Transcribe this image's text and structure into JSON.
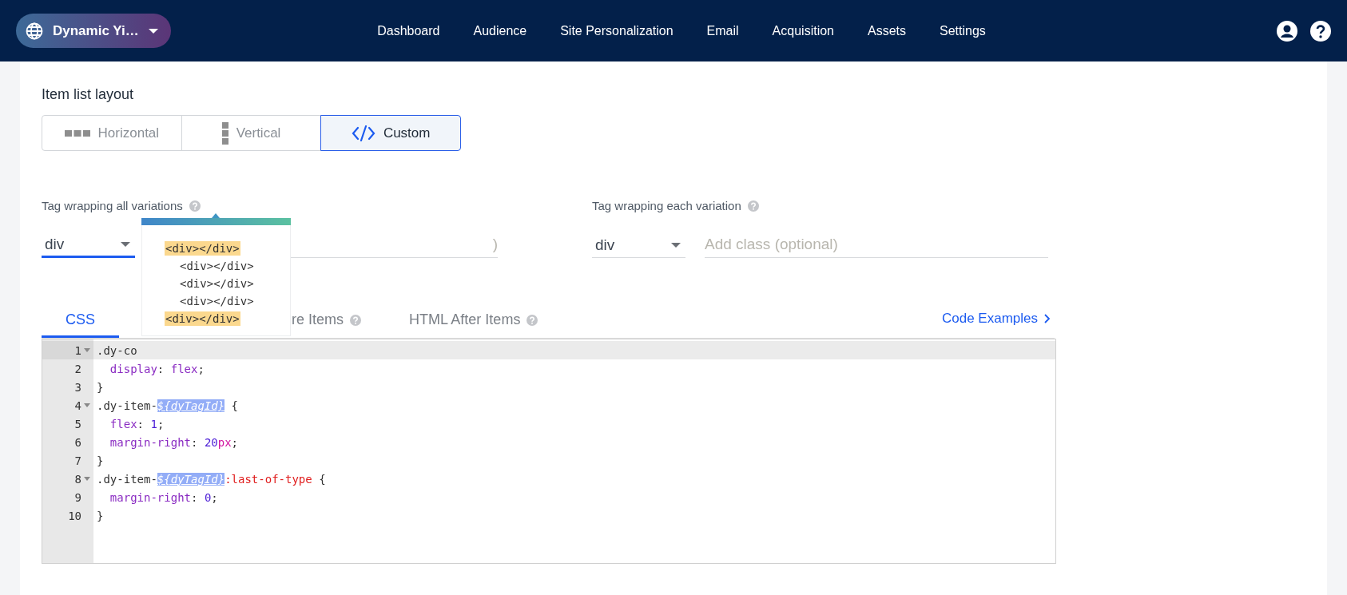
{
  "navbar": {
    "brand": "Dynamic Yi…",
    "links": [
      "Dashboard",
      "Audience",
      "Site Personalization",
      "Email",
      "Acquisition",
      "Assets",
      "Settings"
    ]
  },
  "layout": {
    "title": "Item list layout",
    "options": [
      {
        "label": "Horizontal",
        "kind": "horizontal",
        "selected": false
      },
      {
        "label": "Vertical",
        "kind": "vertical",
        "selected": false
      },
      {
        "label": "Custom",
        "kind": "code",
        "selected": true
      }
    ]
  },
  "wrap_all": {
    "label": "Tag wrapping all variations",
    "tag": "div",
    "focused": true,
    "class_placeholder": ")"
  },
  "wrap_each": {
    "label": "Tag wrapping each variation",
    "tag": "div",
    "focused": false,
    "class_placeholder": "Add class (optional)"
  },
  "tooltip": {
    "lines": [
      {
        "text": "<div></div>",
        "highlighted": true,
        "children": [
          {
            "text": "<div></div>",
            "highlighted": false
          },
          {
            "text": "<div></div>",
            "highlighted": false
          },
          {
            "text": "<div></div>",
            "highlighted": false
          }
        ]
      },
      {
        "text": "<div></div>",
        "highlighted": true
      }
    ]
  },
  "code_tabs": [
    {
      "label": "CSS",
      "selected": true,
      "help": false
    },
    {
      "label": "re Items",
      "selected": false,
      "help": true
    },
    {
      "label": "HTML After Items",
      "selected": false,
      "help": true
    }
  ],
  "code_examples": "Code Examples",
  "editor": {
    "lines": [
      {
        "number": "1",
        "folds": true,
        "active": true,
        "tokens": [
          {
            "text": ".dy-co",
            "kind": "plain"
          }
        ]
      },
      {
        "number": "2",
        "folds": false,
        "active": false,
        "tokens": [
          {
            "text": "  display",
            "kind": "property"
          },
          {
            "text": ": ",
            "kind": "plain"
          },
          {
            "text": "flex",
            "kind": "property"
          },
          {
            "text": ";",
            "kind": "plain"
          }
        ]
      },
      {
        "number": "3",
        "folds": false,
        "active": false,
        "tokens": [
          {
            "text": "}",
            "kind": "plain"
          }
        ]
      },
      {
        "number": "4",
        "folds": true,
        "active": false,
        "tokens": [
          {
            "text": ".dy-item-",
            "kind": "plain"
          },
          {
            "text": "${dyTagId}",
            "kind": "variable"
          },
          {
            "text": " {",
            "kind": "plain"
          }
        ]
      },
      {
        "number": "5",
        "folds": false,
        "active": false,
        "tokens": [
          {
            "text": "  flex",
            "kind": "property"
          },
          {
            "text": ": ",
            "kind": "plain"
          },
          {
            "text": "1",
            "kind": "number"
          },
          {
            "text": ";",
            "kind": "plain"
          }
        ]
      },
      {
        "number": "6",
        "folds": false,
        "active": false,
        "tokens": [
          {
            "text": "  margin-right",
            "kind": "property"
          },
          {
            "text": ": ",
            "kind": "plain"
          },
          {
            "text": "20",
            "kind": "number"
          },
          {
            "text": "px",
            "kind": "unit"
          },
          {
            "text": ";",
            "kind": "plain"
          }
        ]
      },
      {
        "number": "7",
        "folds": false,
        "active": false,
        "tokens": [
          {
            "text": "}",
            "kind": "plain"
          }
        ]
      },
      {
        "number": "8",
        "folds": true,
        "active": false,
        "tokens": [
          {
            "text": ".dy-item-",
            "kind": "plain"
          },
          {
            "text": "${dyTagId}",
            "kind": "variable"
          },
          {
            "text": ":last-of-type",
            "kind": "pseudo"
          },
          {
            "text": " {",
            "kind": "plain"
          }
        ]
      },
      {
        "number": "9",
        "folds": false,
        "active": false,
        "tokens": [
          {
            "text": "  margin-right",
            "kind": "property"
          },
          {
            "text": ": ",
            "kind": "plain"
          },
          {
            "text": "0",
            "kind": "number"
          },
          {
            "text": ";",
            "kind": "plain"
          }
        ]
      },
      {
        "number": "10",
        "folds": false,
        "active": false,
        "tokens": [
          {
            "text": "}",
            "kind": "plain"
          }
        ]
      }
    ]
  }
}
